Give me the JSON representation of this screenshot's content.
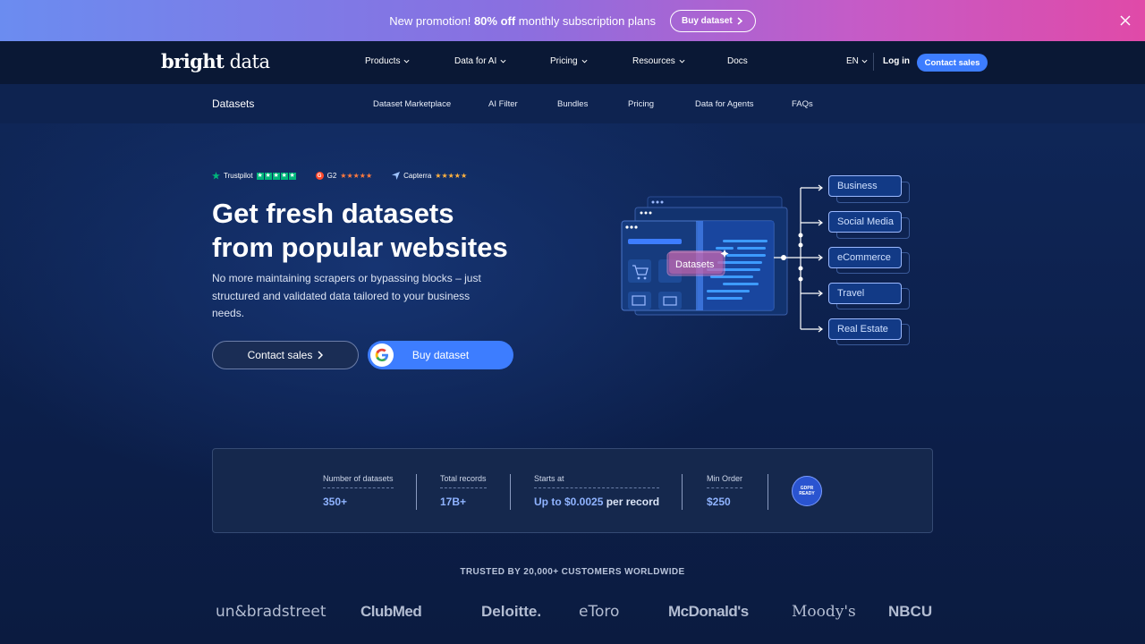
{
  "promo": {
    "text_before": "New promotion! ",
    "text_bold": "80% off",
    "text_after": " monthly subscription plans",
    "button": "Buy dataset"
  },
  "header": {
    "logo_bold": "bright",
    "logo_thin": " data",
    "nav": [
      "Products",
      "Data for AI",
      "Pricing",
      "Resources",
      "Docs"
    ],
    "lang": "EN",
    "login": "Log in",
    "contact": "Contact sales"
  },
  "subnav": {
    "title": "Datasets",
    "items": [
      "Dataset Marketplace",
      "AI Filter",
      "Bundles",
      "Pricing",
      "Data for Agents",
      "FAQs"
    ]
  },
  "ratings": {
    "trustpilot": "Trustpilot",
    "g2": "G2",
    "capterra": "Capterra"
  },
  "hero": {
    "title_line1": "Get fresh datasets",
    "title_line2": "from popular websites",
    "subtitle": "No more maintaining scrapers or bypassing blocks – just structured and validated data tailored to your business needs.",
    "contact_button": "Contact sales",
    "buy_button": "Buy dataset"
  },
  "illustration": {
    "center_label": "Datasets",
    "categories": [
      "Business",
      "Social Media",
      "eCommerce",
      "Travel",
      "Real Estate"
    ]
  },
  "stats": {
    "items": [
      {
        "label": "Number of datasets",
        "value": "350+"
      },
      {
        "label": "Total records",
        "value": "17B+"
      },
      {
        "label": "Starts at",
        "value": "Up to $0.0025",
        "value_suffix": " per record"
      },
      {
        "label": "Min Order",
        "value": "$250"
      }
    ],
    "badge": "GDPR READY"
  },
  "trusted": {
    "title": "TRUSTED BY 20,000+ CUSTOMERS WORLDWIDE",
    "brands": [
      "un&bradstreet",
      "ClubMed",
      "Deloitte.",
      "eToro",
      "McDonald's",
      "Moody's",
      "NBCU"
    ]
  },
  "colors": {
    "accent": "#3d7dff",
    "page_bg": "#0a1a3a",
    "banner_start": "#6b8cf0",
    "banner_end": "#e04aa8"
  }
}
